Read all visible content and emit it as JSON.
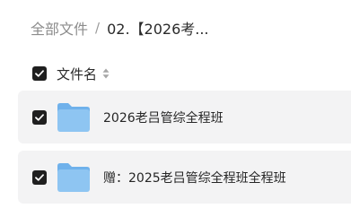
{
  "breadcrumb": {
    "root": "全部文件",
    "separator": "/",
    "current": "02.【2026考..."
  },
  "list_header": {
    "name_label": "文件名",
    "checked": true
  },
  "files": [
    {
      "name": "2026老吕管综全程班",
      "type": "folder",
      "checked": true
    },
    {
      "name": "赠：2025老吕管综全程班全程班",
      "type": "folder",
      "checked": true
    }
  ],
  "colors": {
    "checkbox": "#1f1f1f",
    "row_background": "#f3f3f4",
    "folder_body": "#8ec5f2",
    "folder_tab": "#6fb1eb",
    "muted_text": "#8c8c8c"
  }
}
